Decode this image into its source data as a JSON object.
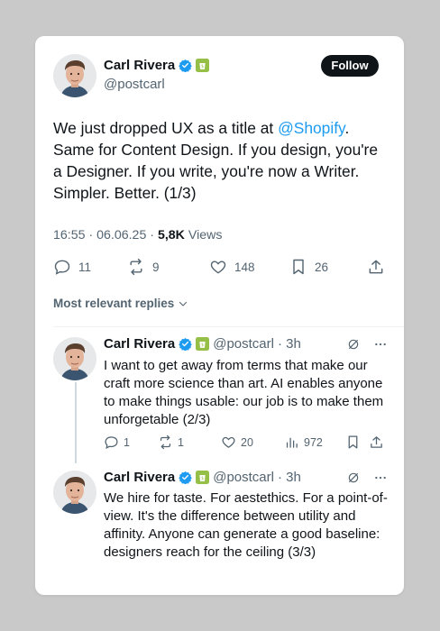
{
  "main": {
    "name": "Carl Rivera",
    "handle": "@postcarl",
    "follow_label": "Follow",
    "text_before": "We just dropped UX as a title at ",
    "mention": "@Shopify",
    "text_after": ". Same for Content Design. If you design, you're a Designer. If you write, you're now a Writer. Simpler. Better. (1/3)",
    "time_date": "16:55 · 06.06.25 · ",
    "views_count": "5,8K",
    "views_label": " Views",
    "replies_count": "11",
    "reposts_count": "9",
    "likes_count": "148",
    "bookmarks_count": "26"
  },
  "replies_toggle": "Most relevant replies",
  "replies": [
    {
      "name": "Carl Rivera",
      "handle": "@postcarl",
      "age": "· 3h",
      "text": "I want to get away from terms that make our craft more science than art. AI enables anyone to make things usable: our job is to make them unforgetable (2/3)",
      "replies_count": "1",
      "reposts_count": "1",
      "likes_count": "20",
      "views_count": "972"
    },
    {
      "name": "Carl Rivera",
      "handle": "@postcarl",
      "age": "· 3h",
      "text": "We hire for taste. For aestethics. For a point-of-view. It's the difference between utility and affinity. Anyone can generate a good baseline: designers reach for the ceiling (3/3)"
    }
  ],
  "colors": {
    "accent": "#1d9bf0",
    "verified": "#1d9bf0",
    "shopify": "#95bf47",
    "text": "#0f1419",
    "muted": "#536471"
  },
  "icons": [
    "verified-icon",
    "shopify-badge-icon",
    "reply-icon",
    "repost-icon",
    "like-icon",
    "bookmark-icon",
    "share-icon",
    "views-icon",
    "grok-icon",
    "more-icon",
    "chevron-down-icon"
  ]
}
